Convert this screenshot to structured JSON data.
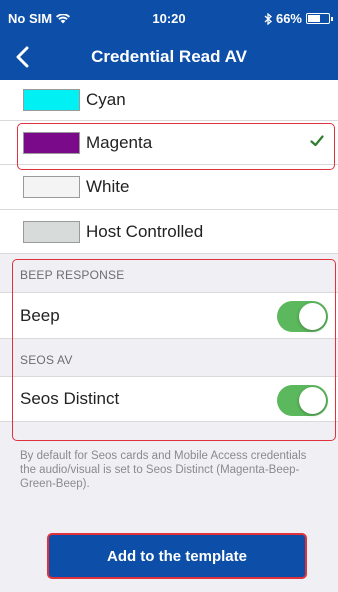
{
  "status_bar": {
    "carrier": "No SIM",
    "time": "10:20",
    "battery_text": "66%",
    "battery_level": 0.66,
    "icons": [
      "wifi-icon",
      "bluetooth-icon",
      "battery-icon"
    ]
  },
  "nav": {
    "back_icon": "chevron-left-icon",
    "title": "Credential Read AV"
  },
  "colors": {
    "header_bg": "#0c4ea8",
    "highlight": "#e0323c",
    "toggle_on": "#5cb85c",
    "check": "#2e7d32"
  },
  "color_options": [
    {
      "label": "Cyan",
      "swatch": "#00f0f4",
      "selected": false
    },
    {
      "label": "Magenta",
      "swatch": "#7a0a8a",
      "selected": true
    },
    {
      "label": "White",
      "swatch": "#f4f4f4",
      "selected": false
    },
    {
      "label": "Host Controlled",
      "swatch": "#d7dcdb",
      "selected": false
    }
  ],
  "beep_section": {
    "header": "BEEP RESPONSE",
    "label": "Beep",
    "enabled": true
  },
  "seos_section": {
    "header": "SEOS AV",
    "label": "Seos Distinct",
    "enabled": true
  },
  "footnote": "By default for Seos cards and Mobile Access credentials the audio/visual is set to Seos Distinct (Magenta-Beep-Green-Beep).",
  "add_button": {
    "label": "Add to the template"
  }
}
